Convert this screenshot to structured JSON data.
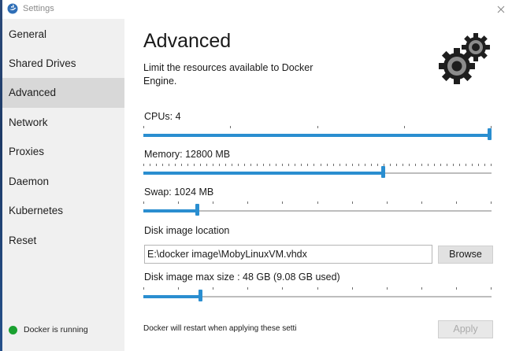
{
  "window": {
    "title": "Settings"
  },
  "sidebar": {
    "items": [
      {
        "label": "General"
      },
      {
        "label": "Shared Drives"
      },
      {
        "label": "Advanced",
        "selected": true
      },
      {
        "label": "Network"
      },
      {
        "label": "Proxies"
      },
      {
        "label": "Daemon"
      },
      {
        "label": "Kubernetes"
      },
      {
        "label": "Reset"
      }
    ],
    "status": {
      "text": "Docker is running",
      "color": "#1aa130"
    }
  },
  "main": {
    "title": "Advanced",
    "description": "Limit the resources available to Docker Engine.",
    "cpus": {
      "label": "CPUs: 4",
      "value_fraction": 1.0
    },
    "memory": {
      "label": "Memory: 12800 MB",
      "value_fraction": 0.69
    },
    "swap": {
      "label": "Swap: 1024 MB",
      "value_fraction": 0.15
    },
    "disk_location": {
      "label": "Disk image location",
      "value": "E:\\docker image\\MobyLinuxVM.vhdx",
      "browse_label": "Browse"
    },
    "disk_size": {
      "label": "Disk image max size : 48 GB (9.08 GB  used)",
      "value_fraction": 0.16
    },
    "footer_note": "Docker will restart when applying these setti",
    "apply_label": "Apply"
  },
  "colors": {
    "accent": "#2a8ed0",
    "selected_nav": "#d8d8d8",
    "sidebar_bg": "#f0f0f0"
  }
}
